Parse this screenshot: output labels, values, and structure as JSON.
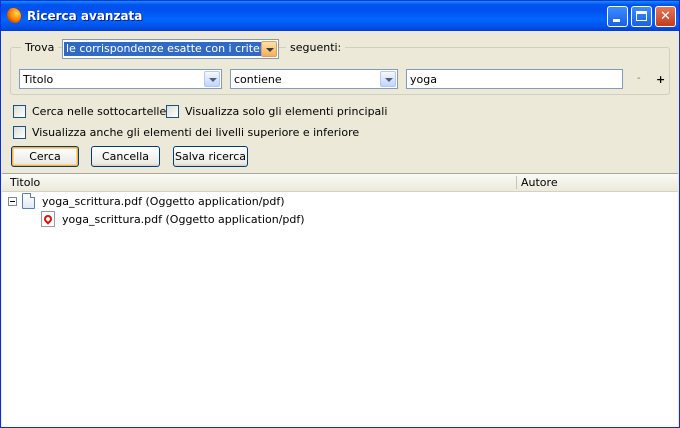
{
  "window": {
    "title": "Ricerca avanzata",
    "accent": "#0053ee"
  },
  "criteria": {
    "find_label": "Trova",
    "match_mode": "le corrispondenze esatte con i criteri",
    "following_label": "seguenti:",
    "field": "Titolo",
    "operator": "contiene",
    "value": "yoga",
    "remove_label": "-",
    "add_label": "+"
  },
  "options": {
    "search_subfolders": "Cerca nelle sottocartelle",
    "show_main_only": "Visualizza solo gli elementi principali",
    "show_parents_children": "Visualizza anche gli elementi dei livelli superiore e inferiore"
  },
  "buttons": {
    "search": "Cerca",
    "clear": "Cancella",
    "save": "Salva ricerca"
  },
  "results": {
    "columns": [
      "Titolo",
      "Autore"
    ],
    "items": [
      {
        "title": "yoga_scrittura.pdf (Oggetto application/pdf)",
        "icon": "document-icon"
      },
      {
        "title": "yoga_scrittura.pdf (Oggetto application/pdf)",
        "icon": "pdf-icon"
      }
    ]
  }
}
